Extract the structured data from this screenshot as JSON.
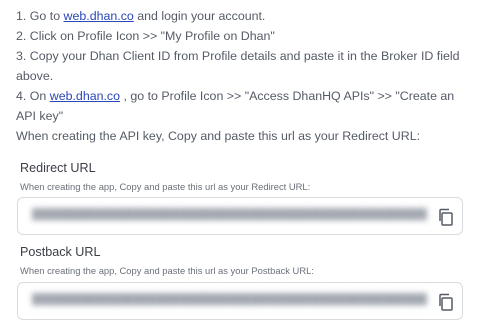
{
  "instructions": {
    "step1_prefix": "1. Go to ",
    "step1_link": "web.dhan.co",
    "step1_suffix": " and login your account.",
    "step2": "2. Click on Profile Icon >> \"My Profile on Dhan\"",
    "step3": "3. Copy your Dhan Client ID from Profile details and paste it in the Broker ID field above.",
    "step4_prefix": "4. On ",
    "step4_link": "web.dhan.co",
    "step4_suffix": " , go to Profile Icon >> \"Access DhanHQ APIs\" >> \"Create an API key\"",
    "note": "When creating the API key, Copy and paste this url as your Redirect URL:"
  },
  "redirect": {
    "label": "Redirect URL",
    "help": "When creating the app, Copy and paste this url as your Redirect URL:",
    "copy_icon": "copy-icon"
  },
  "postback": {
    "label": "Postback URL",
    "help": "When creating the app, Copy and paste this url as your Postback URL:",
    "copy_icon": "copy-icon"
  },
  "colors": {
    "link": "#2b47b8",
    "border": "#d8dbe0",
    "text": "#555b66"
  }
}
